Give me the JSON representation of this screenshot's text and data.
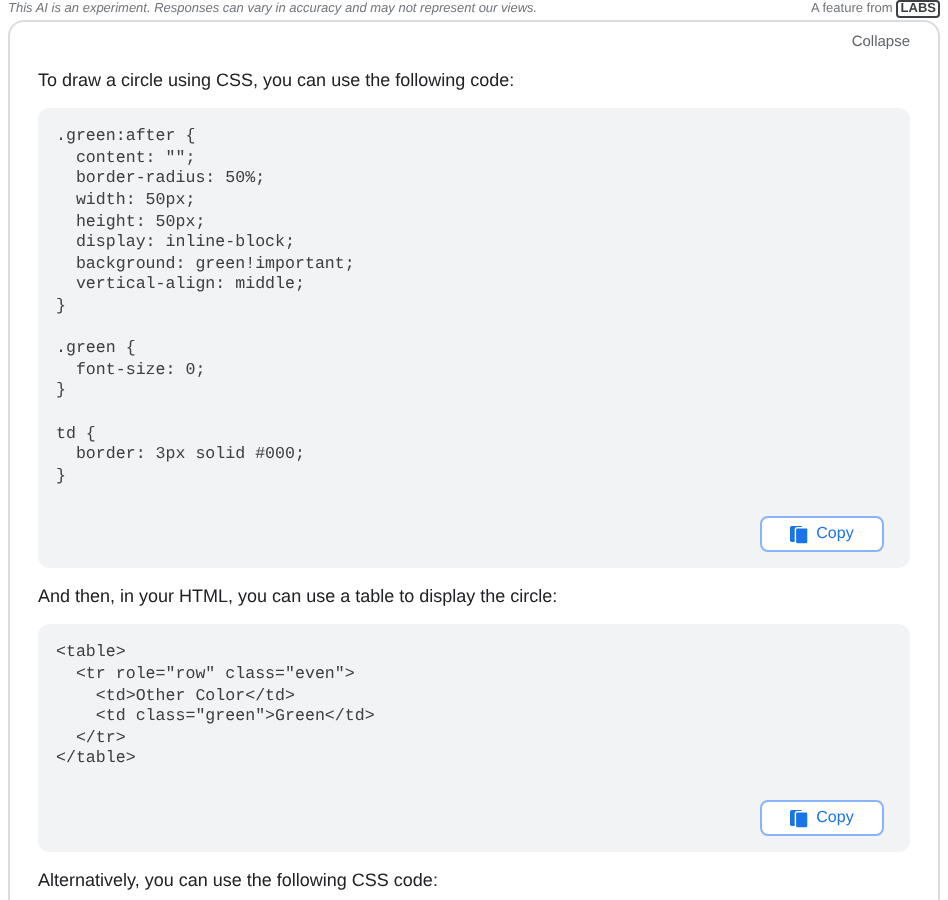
{
  "disclaimer": "This AI is an experiment. Responses can vary in accuracy and may not represent our views.",
  "feature_note": {
    "text": "A feature from",
    "badge": "LABS"
  },
  "collapse": "Collapse",
  "blocks": [
    {
      "kind": "paragraph",
      "text": "To draw a circle using CSS, you can use the following code:"
    },
    {
      "kind": "code",
      "sections": [
        [
          ".green:after {",
          "  content: \"\";",
          "  border-radius: 50%;",
          "  width: 50px;",
          "  height: 50px;",
          "  display: inline-block;",
          "  background: green!important;",
          "  vertical-align: middle;",
          "}"
        ],
        [
          ".green {",
          "  font-size: 0;",
          "}"
        ],
        [
          "td {",
          "  border: 3px solid #000;",
          "}"
        ]
      ],
      "copy": "Copy"
    },
    {
      "kind": "paragraph",
      "text": "And then, in your HTML, you can use a table to display the circle:"
    },
    {
      "kind": "code",
      "sections": [
        [
          "<table>",
          "  <tr role=\"row\" class=\"even\">",
          "    <td>Other Color</td>",
          "    <td class=\"green\">Green</td>",
          "  </tr>",
          "</table>"
        ]
      ],
      "copy": "Copy"
    },
    {
      "kind": "paragraph",
      "text": "Alternatively, you can use the following CSS code:"
    }
  ]
}
